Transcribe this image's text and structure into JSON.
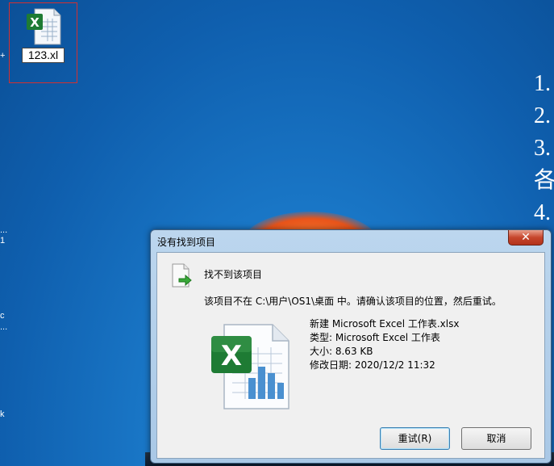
{
  "desktop": {
    "file_icon_label": "123.xl",
    "left_edge_marks": [
      "+",
      "...",
      "1",
      "c",
      "...",
      "k"
    ],
    "right_note_lines": [
      "1.",
      "2.",
      "3.",
      "各",
      "4."
    ]
  },
  "dialog": {
    "title": "没有找到项目",
    "close_glyph": "✕",
    "heading": "找不到该项目",
    "message": "该项目不在 C:\\用户\\OS1\\桌面 中。请确认该项目的位置，然后重试。",
    "file": {
      "name": "新建 Microsoft Excel 工作表.xlsx",
      "type": "类型: Microsoft Excel 工作表",
      "size": "大小: 8.63 KB",
      "modified": "修改日期: 2020/12/2 11:32"
    },
    "buttons": {
      "retry": "重试(R)",
      "cancel": "取消"
    }
  },
  "colors": {
    "desktop_blue": "#1a78c8",
    "excel_green": "#1e7b34",
    "close_red": "#c6462c"
  }
}
